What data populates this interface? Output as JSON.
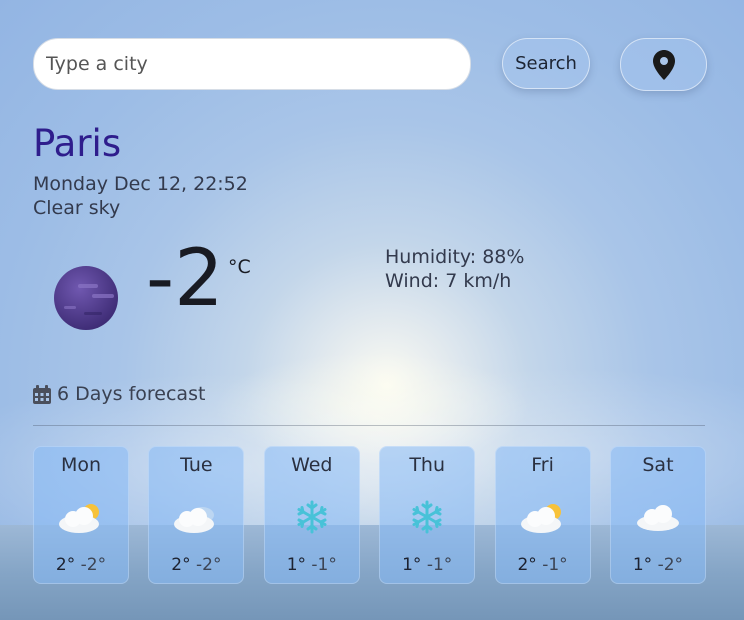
{
  "search": {
    "placeholder": "Type a city",
    "button_label": "Search"
  },
  "current": {
    "city": "Paris",
    "datetime": "Monday Dec 12, 22:52",
    "description": "Clear sky",
    "temperature": "-2",
    "unit": "°C",
    "humidity": "Humidity: 88%",
    "wind": "Wind: 7 km/h",
    "icon": "moon-icon"
  },
  "forecast": {
    "title": "6 Days forecast",
    "days": [
      {
        "day": "Mon",
        "max": "2°",
        "min": "-2°",
        "icon": "partly-cloudy-icon"
      },
      {
        "day": "Tue",
        "max": "2°",
        "min": "-2°",
        "icon": "cloudy-icon"
      },
      {
        "day": "Wed",
        "max": "1°",
        "min": "-1°",
        "icon": "snow-icon"
      },
      {
        "day": "Thu",
        "max": "1°",
        "min": "-1°",
        "icon": "snow-icon"
      },
      {
        "day": "Fri",
        "max": "2°",
        "min": "-1°",
        "icon": "partly-cloudy-icon"
      },
      {
        "day": "Sat",
        "max": "1°",
        "min": "-2°",
        "icon": "cloud-icon"
      }
    ]
  },
  "colors": {
    "city": "#2e1d8c",
    "card": "#87b9f5",
    "accent": "#48c2d8"
  }
}
